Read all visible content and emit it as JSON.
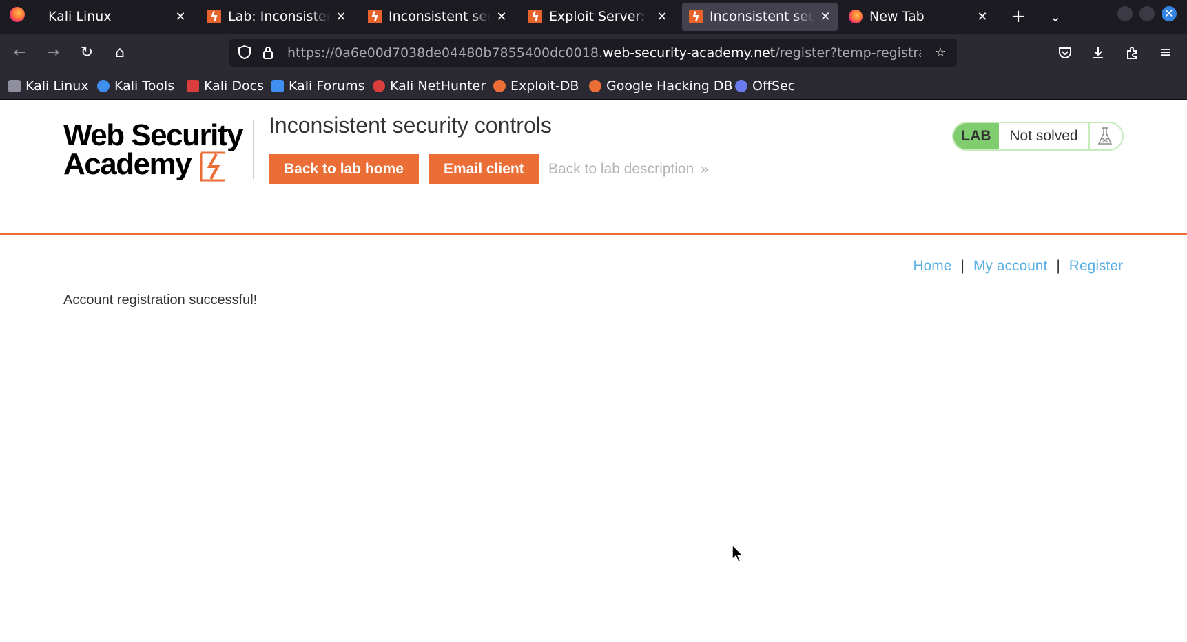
{
  "browser": {
    "tabs": [
      {
        "title": "Kali Linux",
        "favicon": "kali-icon",
        "active": false
      },
      {
        "title": "Lab: Inconsistent security controls",
        "favicon": "portswigger-icon",
        "active": false
      },
      {
        "title": "Inconsistent security controls",
        "favicon": "portswigger-icon",
        "active": false
      },
      {
        "title": "Exploit Server: Inconsistent security controls",
        "favicon": "portswigger-icon",
        "active": false
      },
      {
        "title": "Inconsistent security controls",
        "favicon": "portswigger-icon",
        "active": true
      },
      {
        "title": "New Tab",
        "favicon": "firefox-icon",
        "active": false
      }
    ],
    "url": {
      "prefix": "https://0a6e00d7038de04480b7855400dc0018.",
      "domain": "web-security-academy.net",
      "path": "/register?temp-registration-token=..."
    },
    "bookmarks": [
      {
        "label": "Kali Linux",
        "icon": "kali-dragon-icon",
        "color": "#8f8f9d"
      },
      {
        "label": "Kali Tools",
        "icon": "kali-tools-icon",
        "color": "#3f8ff0"
      },
      {
        "label": "Kali Docs",
        "icon": "kali-docs-icon",
        "color": "#d93d3d"
      },
      {
        "label": "Kali Forums",
        "icon": "kali-forums-icon",
        "color": "#3f8ff0"
      },
      {
        "label": "Kali NetHunter",
        "icon": "nethunter-icon",
        "color": "#d93d3d"
      },
      {
        "label": "Exploit-DB",
        "icon": "exploit-db-icon",
        "color": "#ec6e37"
      },
      {
        "label": "Google Hacking DB",
        "icon": "ghdb-icon",
        "color": "#ec6e37"
      },
      {
        "label": "OffSec",
        "icon": "offsec-icon",
        "color": "#6a7cf0"
      }
    ]
  },
  "page": {
    "logo": {
      "line1": "Web Security",
      "line2": "Academy"
    },
    "lab_title": "Inconsistent security controls",
    "buttons": {
      "back_to_lab_home": "Back to lab home",
      "email_client": "Email client",
      "back_to_description": "Back to lab description"
    },
    "lab_status": {
      "badge": "LAB",
      "state": "Not solved"
    },
    "nav_links": {
      "home": "Home",
      "my_account": "My account",
      "register": "Register",
      "separator": "|"
    },
    "message": "Account registration successful!"
  },
  "colors": {
    "accent_orange": "#ec6e37",
    "link_blue": "#5ab0e3",
    "lab_green": "#7fcd6e"
  }
}
